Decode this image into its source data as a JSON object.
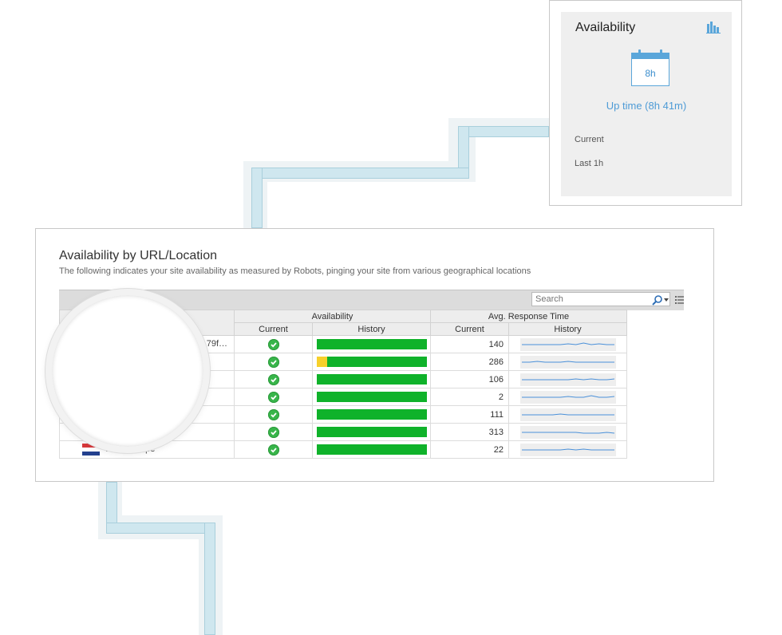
{
  "widget": {
    "title": "Availability",
    "chart_icon": "bar-chart-icon",
    "calendar_icon": "calendar-icon",
    "calendar_value": "8h",
    "uptime": "Up time (8h 41m)",
    "metrics": [
      "Current",
      "Last 1h"
    ]
  },
  "panel": {
    "title": "Availability by URL/Location",
    "subtitle": "The following indicates your site availability as measured by Robots, pinging your site from various geographical locations",
    "search_placeholder": "Search",
    "search_icon": "search-icon",
    "columns_icon": "column-chooser-icon",
    "groups": [
      "Availability",
      "Avg. Response Time"
    ],
    "columns": [
      "Current",
      "History",
      "Current",
      "History"
    ],
    "colors": {
      "status_up": "#38b54a",
      "history_up": "#0fb22a",
      "history_degraded": "#f7d02a",
      "sparkline": "#4a90d9"
    },
    "rows": [
      {
        "location": "79f…",
        "status": "up",
        "response": "140",
        "degraded_fraction": 0
      },
      {
        "location": "",
        "status": "up",
        "response": "286",
        "degraded_fraction": 0.1
      },
      {
        "location": "",
        "status": "up",
        "response": "106",
        "degraded_fraction": 0
      },
      {
        "location": "",
        "status": "up",
        "response": "2",
        "degraded_fraction": 0
      },
      {
        "location": "",
        "status": "up",
        "response": "111",
        "degraded_fraction": 0
      },
      {
        "location": "",
        "status": "up",
        "response": "313",
        "degraded_fraction": 0
      },
      {
        "location": "West Europe",
        "status": "up",
        "response": "22",
        "degraded_fraction": 0
      }
    ]
  }
}
